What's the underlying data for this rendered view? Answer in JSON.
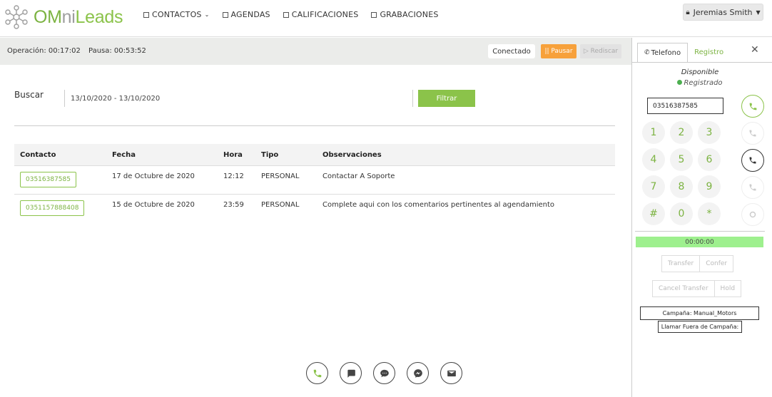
{
  "brand": {
    "om": "OM",
    "ni": "ni",
    "leads": "Leads"
  },
  "nav": {
    "contactos": "CONTACTOS",
    "agendas": "AGENDAS",
    "calificaciones": "CALIFICACIONES",
    "grabaciones": "GRABACIONES"
  },
  "user": {
    "name": "Jeremias Smith"
  },
  "status": {
    "operacion": "Operación: 00:17:02",
    "pausa": "Pausa: 00:53:52",
    "conectado": "Conectado",
    "pausar": "|| Pausar",
    "rediscar": "▷ Rediscar"
  },
  "search": {
    "label": "Buscar",
    "date_range": "13/10/2020 - 13/10/2020",
    "filtrar": "Filtrar"
  },
  "table": {
    "headers": [
      "Contacto",
      "Fecha",
      "Hora",
      "Tipo",
      "Observaciones"
    ],
    "rows": [
      {
        "contacto": "03516387585",
        "fecha": "17 de Octubre de 2020",
        "hora": "12:12",
        "tipo": "PERSONAL",
        "obs": "Contactar A Soporte"
      },
      {
        "contacto": "0351157888408",
        "fecha": "15 de Octubre de 2020",
        "hora": "23:59",
        "tipo": "PERSONAL",
        "obs": "Complete aqui con los comentarios pertinentes al agendamiento"
      }
    ]
  },
  "phone": {
    "tab_telefono": "Telefono",
    "tab_registro": "Registro",
    "disponible": "Disponible",
    "registrado": "Registrado",
    "number": "03516387585",
    "keys": [
      "1",
      "2",
      "3",
      "4",
      "5",
      "6",
      "7",
      "8",
      "9",
      "#",
      "0",
      "*"
    ],
    "timer": "00:00:00",
    "transfer": "Transfer",
    "confer": "Confer",
    "cancel_transfer": "Cancel Transfer",
    "hold": "Hold",
    "campana": "Campaña: Manual_Motors",
    "llamar_fuera": "Llamar Fuera de Campaña:"
  }
}
